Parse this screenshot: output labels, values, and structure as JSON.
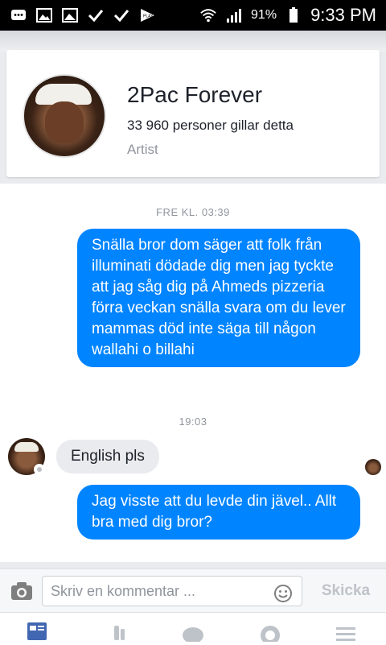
{
  "status_bar": {
    "left_icons": [
      "message-icon",
      "gallery-icon",
      "image-icon",
      "check-icon",
      "check-icon",
      "play-store-icon"
    ],
    "battery": "91%",
    "time": "9:33 PM"
  },
  "page": {
    "name": "2Pac Forever",
    "likes": "33 960 personer gillar detta",
    "category": "Artist"
  },
  "conversation": {
    "messages": [
      {
        "type": "timestamp",
        "text": "FRE KL. 03:39"
      },
      {
        "type": "outgoing",
        "text": "Snälla bror dom säger att folk från illuminati dödade dig men jag tyckte att jag såg dig på Ahmeds pizzeria förra veckan snälla svara om du lever mammas död inte säga till någon wallahi o billahi"
      },
      {
        "type": "timestamp",
        "text": "19:03"
      },
      {
        "type": "incoming",
        "text": "English pls"
      },
      {
        "type": "outgoing",
        "text": "Jag visste att du levde din jävel.. Allt bra med dig bror?"
      }
    ]
  },
  "composer": {
    "placeholder": "Skriv en kommentar ...",
    "send_label": "Skicka"
  },
  "colors": {
    "accent": "#0084ff",
    "incoming_bubble": "#e9ebee",
    "tab_active": "#4267b2"
  }
}
